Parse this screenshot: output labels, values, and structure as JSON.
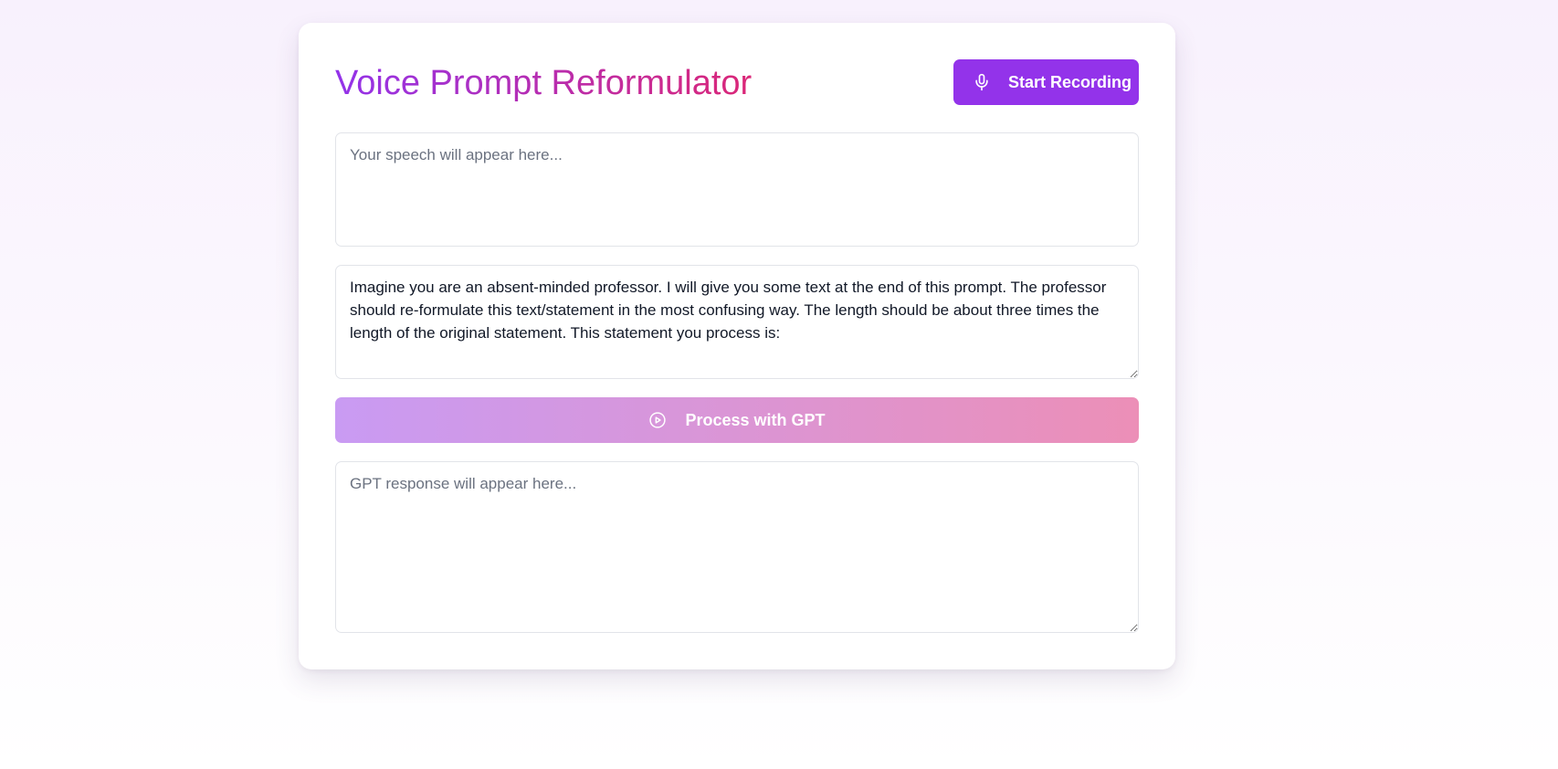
{
  "app": {
    "title": "Voice Prompt Reformulator"
  },
  "header": {
    "record_button": {
      "label": "Start Recording",
      "icon": "microphone-icon"
    }
  },
  "speech_input": {
    "value": "",
    "placeholder": "Your speech will appear here..."
  },
  "prompt_input": {
    "value": "Imagine you are an absent-minded professor. I will give you some text at the end of this prompt. The professor should re-formulate this text/statement in the most confusing way. The length should be about three times the length of the original statement. This statement you process is:",
    "placeholder": ""
  },
  "process_button": {
    "label": "Process with GPT",
    "icon": "play-circle-icon"
  },
  "response_output": {
    "value": "",
    "placeholder": "GPT response will appear here..."
  },
  "colors": {
    "accent": "#9333ea",
    "title_gradient_start": "#9333ea",
    "title_gradient_end": "#db2777",
    "process_gradient_start": "#c99bf3",
    "process_gradient_end": "#ec8fb7"
  }
}
